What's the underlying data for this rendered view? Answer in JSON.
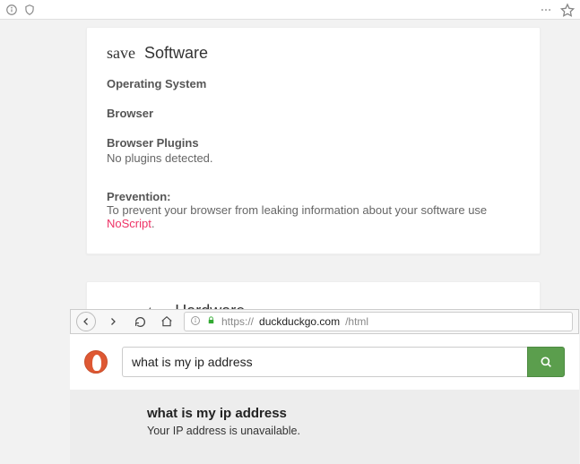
{
  "topChrome": {
    "infoIcon": "info",
    "shieldIcon": "shield",
    "menuIcon": "ellipsis",
    "starIcon": "star"
  },
  "software": {
    "iconWord": "save",
    "title": "Software",
    "os_label": "Operating System",
    "browser_label": "Browser",
    "plugins_label": "Browser Plugins",
    "plugins_value": "No plugins detected.",
    "prevention_label": "Prevention:",
    "prevention_text": "To prevent your browser from leaking information about your software use ",
    "prevention_link": "NoScript",
    "prevention_trail": "."
  },
  "hardware": {
    "iconWord": "computer",
    "title": "Hardware"
  },
  "innerBrowser": {
    "urlPrefix": "https://",
    "urlHost": "duckduckgo.com",
    "urlPath": "/html",
    "searchValue": "what is my ip address"
  },
  "result": {
    "title": "what is my ip address",
    "body": "Your IP address is unavailable."
  }
}
